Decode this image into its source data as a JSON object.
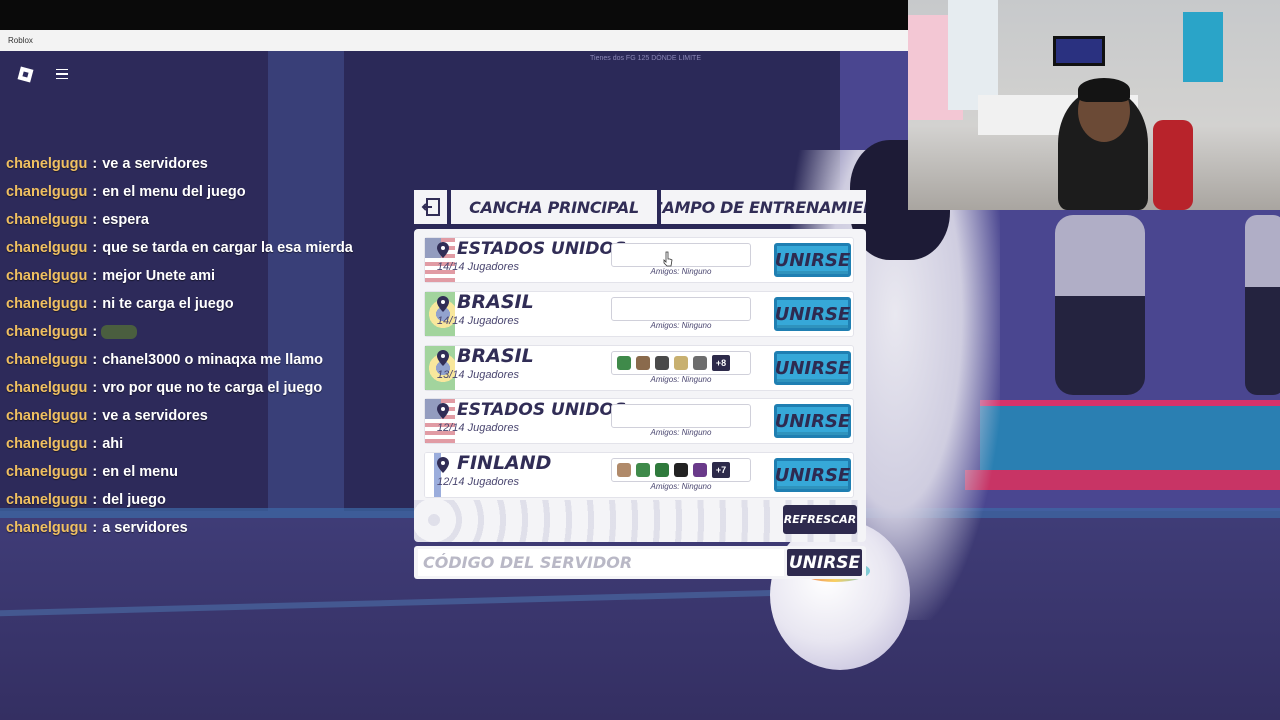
{
  "window": {
    "title": "Roblox"
  },
  "faint_text": "Tienes dos FG 125 DÓNDE LIMITE",
  "chat": [
    {
      "user": "chanelgugu",
      "msg": "ve a servidores"
    },
    {
      "user": "chanelgugu",
      "msg": "en el menu del juego"
    },
    {
      "user": "chanelgugu",
      "msg": "espera"
    },
    {
      "user": "chanelgugu",
      "msg": "que se tarda en cargar la esa mierda"
    },
    {
      "user": "chanelgugu",
      "msg": "mejor Unete ami"
    },
    {
      "user": "chanelgugu",
      "msg": "ni te carga el juego"
    },
    {
      "user": "chanelgugu",
      "msg": "",
      "emoji": "car-emoji"
    },
    {
      "user": "chanelgugu",
      "msg": "chanel3000 o minaqxa me llamo"
    },
    {
      "user": "chanelgugu",
      "msg": "vro por que no te carga el juego"
    },
    {
      "user": "chanelgugu",
      "msg": "ve a servidores"
    },
    {
      "user": "chanelgugu",
      "msg": "ahi"
    },
    {
      "user": "chanelgugu",
      "msg": "en el menu"
    },
    {
      "user": "chanelgugu",
      "msg": "del juego"
    },
    {
      "user": "chanelgugu",
      "msg": "a servidores"
    }
  ],
  "chat_sep": ":",
  "tabs": {
    "main": "CANCHA PRINCIPAL",
    "training": "CAMPO DE ENTRENAMIENTO"
  },
  "servers": [
    {
      "country": "ESTADOS UNIDOS",
      "players": "14/14 Jugadores",
      "friends": "Amigos: Ninguno",
      "flag": "us",
      "avatars": [],
      "more": "",
      "join": "UNIRSE"
    },
    {
      "country": "BRASIL",
      "players": "14/14 Jugadores",
      "friends": "Amigos: Ninguno",
      "flag": "br",
      "avatars": [],
      "more": "",
      "join": "UNIRSE"
    },
    {
      "country": "BRASIL",
      "players": "13/14 Jugadores",
      "friends": "Amigos: Ninguno",
      "flag": "br",
      "avatars": [
        "#3f8a4a",
        "#8a6a4c",
        "#4a4a4a",
        "#c8b070",
        "#6d6d6d"
      ],
      "more": "+8",
      "join": "UNIRSE"
    },
    {
      "country": "ESTADOS UNIDOS",
      "players": "12/14 Jugadores",
      "friends": "Amigos: Ninguno",
      "flag": "us",
      "avatars": [],
      "more": "",
      "join": "UNIRSE"
    },
    {
      "country": "FINLAND",
      "players": "12/14 Jugadores",
      "friends": "Amigos: Ninguno",
      "flag": "fi",
      "avatars": [
        "#b08a6a",
        "#3f8a4a",
        "#2f7a3c",
        "#222222",
        "#6a3a8a"
      ],
      "more": "+7",
      "join": "UNIRSE"
    }
  ],
  "refresh_label": "REFRESCAR",
  "code": {
    "placeholder": "CÓDIGO DEL SERVIDOR",
    "value": "",
    "join": "UNIRSE"
  },
  "colors": {
    "join": "#36a8d8",
    "dark": "#2e2a4e",
    "chat_name": "#f0c061"
  }
}
